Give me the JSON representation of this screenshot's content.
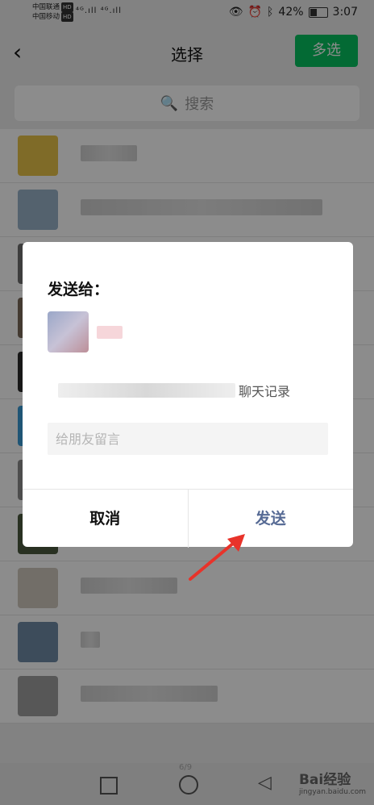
{
  "status_bar": {
    "carrier1": "中国联通",
    "carrier2": "中国移动",
    "hd_badge": "HD",
    "signal": "⁴ᴳ.ıll ⁴ᴳ.ıll",
    "battery_pct": "42%",
    "time": "3:07"
  },
  "nav": {
    "back_label": "‹",
    "title": "选择",
    "multi_select_label": "多选"
  },
  "search": {
    "placeholder": "搜索"
  },
  "contacts": [
    {
      "avatar_color": "#e8c34a"
    },
    {
      "avatar_color": "#9ab2c9"
    },
    {
      "avatar_color": "#6f6f6f"
    },
    {
      "avatar_color": "#7a6a5a"
    },
    {
      "avatar_color": "#2b2b2b"
    },
    {
      "avatar_color": "#3a9bd6"
    },
    {
      "avatar_color": "#8c8c8c"
    },
    {
      "avatar_color": "#4c5a3e"
    },
    {
      "avatar_color": "#cfc8bd"
    },
    {
      "avatar_color": "#6f8aa6"
    },
    {
      "avatar_color": "#9f9f9f"
    }
  ],
  "dialog": {
    "title": "发送给：",
    "chat_record_suffix": "聊天记录",
    "message_placeholder": "给朋友留言",
    "cancel_label": "取消",
    "send_label": "发送"
  },
  "bottom_nav": {
    "page_indicator": "6/9",
    "watermark_brand": "Bai经验",
    "watermark_url": "jingyan.baidu.com"
  },
  "colors": {
    "accent_green": "#07c160",
    "send_blue": "#576b95",
    "arrow_red": "#e8332a"
  }
}
